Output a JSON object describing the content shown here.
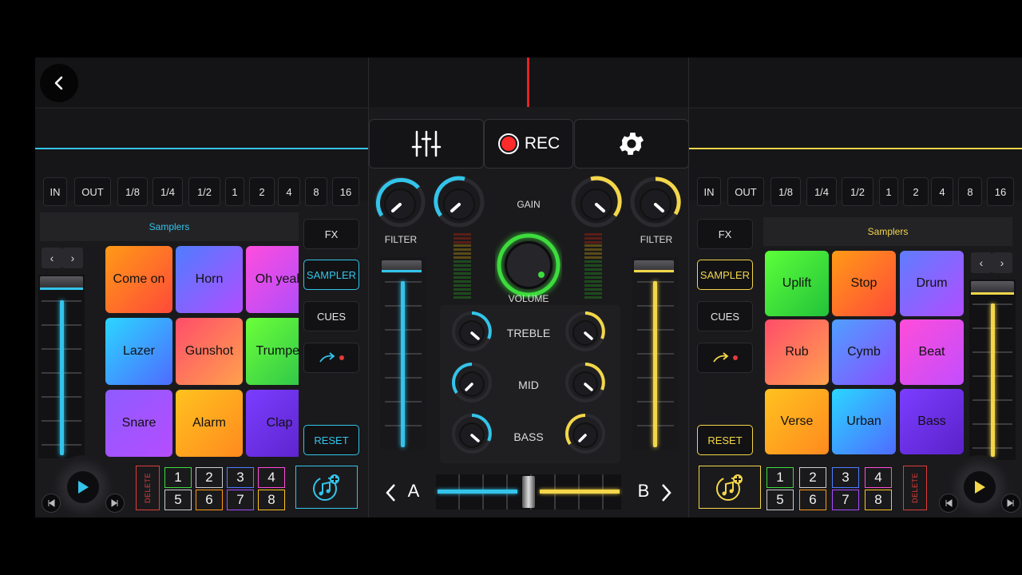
{
  "left": {
    "loop_buttons": [
      "IN",
      "OUT",
      "1/8",
      "1/4",
      "1/2",
      "1",
      "2",
      "4",
      "8",
      "16"
    ],
    "samplers_title": "Samplers",
    "pads": [
      {
        "label": "Come on",
        "colors": [
          "#ff9a16",
          "#ff4a3a"
        ]
      },
      {
        "label": "Horn",
        "colors": [
          "#4f7dff",
          "#b14dff"
        ]
      },
      {
        "label": "Oh yeah",
        "colors": [
          "#ff4dde",
          "#a74dff"
        ]
      },
      {
        "label": "Lazer",
        "colors": [
          "#2ad6ff",
          "#4f6bff"
        ]
      },
      {
        "label": "Gunshot",
        "colors": [
          "#ff4d6a",
          "#ffa14d"
        ]
      },
      {
        "label": "Trumpet",
        "colors": [
          "#6cff3a",
          "#2bc24a"
        ]
      },
      {
        "label": "Snare",
        "colors": [
          "#8e5bff",
          "#b54dff"
        ]
      },
      {
        "label": "Alarm",
        "colors": [
          "#ffc21f",
          "#ff8a1f"
        ]
      },
      {
        "label": "Clap",
        "colors": [
          "#7b3dff",
          "#5b22c9"
        ]
      }
    ],
    "side_buttons": {
      "fx": "FX",
      "sampler": "SAMPLER",
      "cues": "CUES",
      "reset": "RESET"
    },
    "delete_label": "DELETE",
    "numbers": [
      "1",
      "2",
      "3",
      "4",
      "5",
      "6",
      "7",
      "8"
    ],
    "nav": {
      "prev": "‹",
      "next": "›"
    }
  },
  "right": {
    "loop_buttons": [
      "IN",
      "OUT",
      "1/8",
      "1/4",
      "1/2",
      "1",
      "2",
      "4",
      "8",
      "16"
    ],
    "samplers_title": "Samplers",
    "pads": [
      {
        "label": "Uplift",
        "colors": [
          "#5dff3a",
          "#22c23a"
        ]
      },
      {
        "label": "Stop",
        "colors": [
          "#ff9a16",
          "#ff4a3a"
        ]
      },
      {
        "label": "Drum",
        "colors": [
          "#5f7dff",
          "#b14dff"
        ]
      },
      {
        "label": "Rub",
        "colors": [
          "#ff4d6a",
          "#ffa14d"
        ]
      },
      {
        "label": "Cymb",
        "colors": [
          "#4fa0ff",
          "#8a4dff"
        ]
      },
      {
        "label": "Beat",
        "colors": [
          "#ff4dd8",
          "#c24dff"
        ]
      },
      {
        "label": "Verse",
        "colors": [
          "#ffc21f",
          "#ff8a1f"
        ]
      },
      {
        "label": "Urban",
        "colors": [
          "#2ad6ff",
          "#4f6bff"
        ]
      },
      {
        "label": "Bass",
        "colors": [
          "#7b3dff",
          "#5b22c9"
        ]
      }
    ],
    "side_buttons": {
      "fx": "FX",
      "sampler": "SAMPLER",
      "cues": "CUES",
      "reset": "RESET"
    },
    "delete_label": "DELETE",
    "numbers": [
      "1",
      "2",
      "3",
      "4",
      "5",
      "6",
      "7",
      "8"
    ],
    "nav": {
      "prev": "‹",
      "next": "›"
    }
  },
  "mixer": {
    "rec_label": "REC",
    "gain_label": "GAIN",
    "filter_label": "FILTER",
    "volume_label": "VOLUME",
    "treble_label": "TREBLE",
    "mid_label": "MID",
    "bass_label": "BASS",
    "deck_a": "A",
    "deck_b": "B",
    "crossfader_position": 0.5
  },
  "colors": {
    "deck_a": "#33c4ea",
    "deck_b": "#f3d64a",
    "rec": "#ff2a2a",
    "volume": "#3ddc3d",
    "number_borders": [
      "#3ddc3d",
      "#e0e0e0",
      "#4f7dff",
      "#ff4dd8",
      "#e0e0e0",
      "#ff9a16",
      "#a74dff",
      "#ffc21f"
    ]
  }
}
